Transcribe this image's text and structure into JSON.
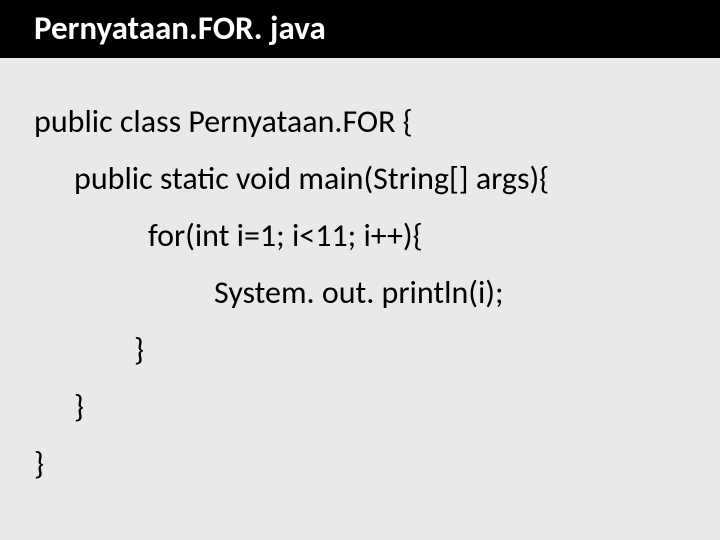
{
  "title": "Pernyataan.FOR. java",
  "code": {
    "l1": "public class Pernyataan.FOR {",
    "l2": "public static void main(String[] args){",
    "l3": "for(int i=1; i<11; i++){",
    "l4": "System. out. println(i);",
    "l5": "}",
    "l6": "}",
    "l7": "}"
  }
}
